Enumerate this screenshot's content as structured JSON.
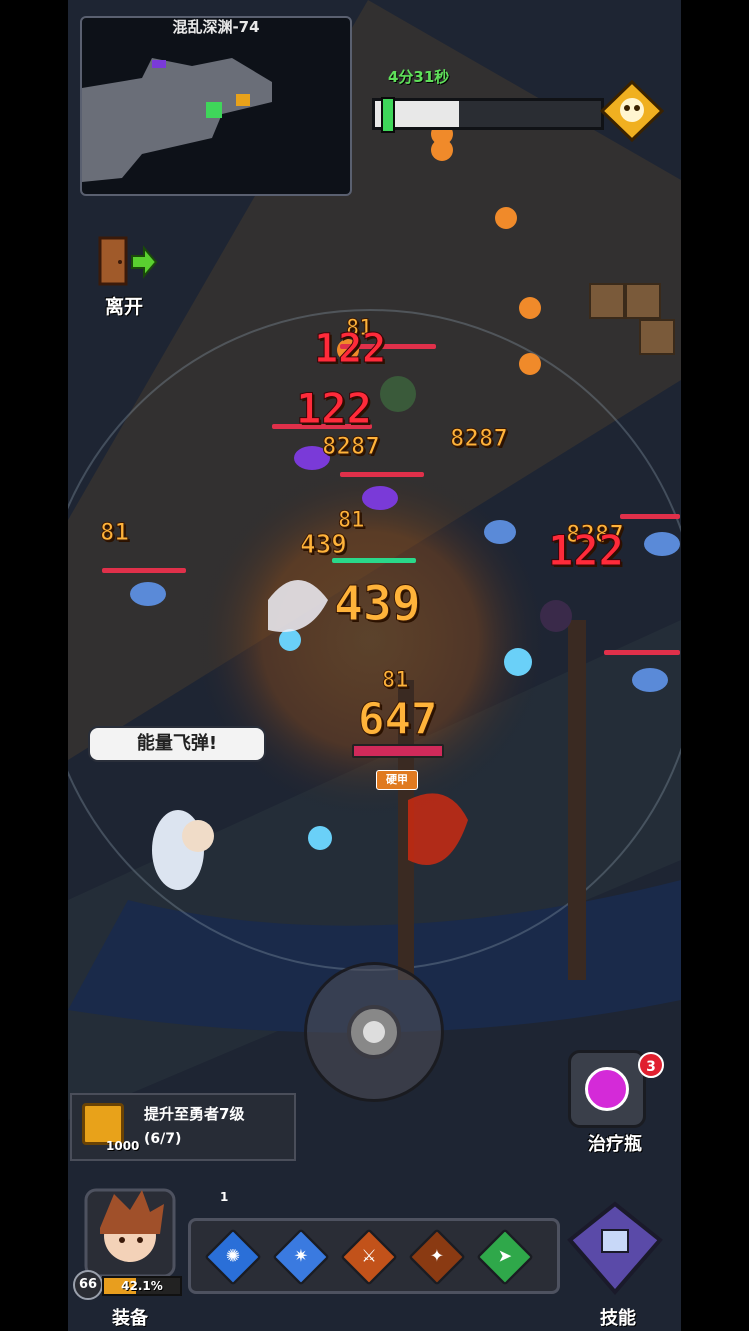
{
  "minimap": {
    "title": "混乱深渊-74"
  },
  "timer": {
    "text": "4分31秒"
  },
  "boss_progress": {
    "fraction": 0.37
  },
  "exit": {
    "label": "离开"
  },
  "damage_numbers": [
    {
      "text": "81",
      "color": "orange"
    },
    {
      "text": "122",
      "color": "red"
    },
    {
      "text": "122",
      "color": "red"
    },
    {
      "text": "8287",
      "color": "orange"
    },
    {
      "text": "8287",
      "color": "orange"
    },
    {
      "text": "81",
      "color": "orange"
    },
    {
      "text": "8287",
      "color": "orange"
    },
    {
      "text": "122",
      "color": "red"
    },
    {
      "text": "81",
      "color": "orange"
    },
    {
      "text": "439",
      "color": "orange"
    },
    {
      "text": "439",
      "color": "orange"
    },
    {
      "text": "81",
      "color": "orange"
    },
    {
      "text": "647",
      "color": "orange"
    }
  ],
  "speech_bubble": {
    "text": "能量飞弹!"
  },
  "armor_tag": {
    "text": "硬甲"
  },
  "quest": {
    "title": "提升至勇者7级",
    "progress": "(6/7)",
    "reward": "1000"
  },
  "potion": {
    "label": "治疗瓶",
    "count": "3"
  },
  "player": {
    "level": "66",
    "xp_text": "42.1%",
    "xp_fraction": 0.421,
    "equip_label": "装备"
  },
  "bag": {
    "count": "1"
  },
  "skills": [
    {
      "name": "ice-orb-skill",
      "color": "#2a6fd8",
      "glyph": "✺"
    },
    {
      "name": "frost-burst-skill",
      "color": "#3a7ae0",
      "glyph": "✷"
    },
    {
      "name": "fire-slash-skill",
      "color": "#c2521a",
      "glyph": "⚔"
    },
    {
      "name": "flame-spear-skill",
      "color": "#8a3a12",
      "glyph": "✦"
    },
    {
      "name": "wind-arrow-skill",
      "color": "#2fa84a",
      "glyph": "➤"
    }
  ],
  "skill_book": {
    "label": "技能"
  },
  "colors": {
    "timer_green": "#5fe05a",
    "damage_orange": "#ffb33a",
    "damage_red": "#ff2b3a",
    "potion_magenta": "#d42ad8"
  }
}
